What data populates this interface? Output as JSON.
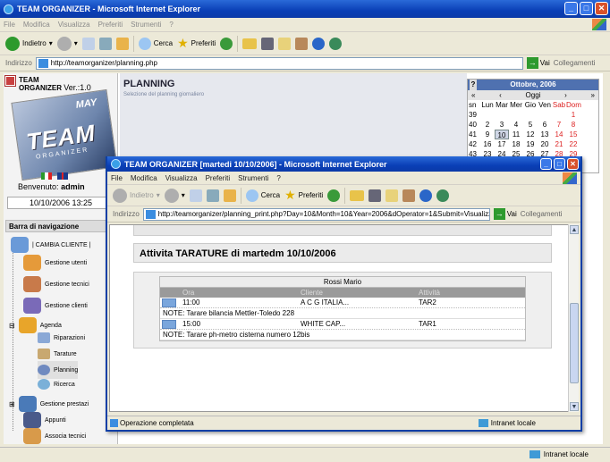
{
  "bg_window": {
    "title": "TEAM ORGANIZER - Microsoft Internet Explorer",
    "menu": [
      "File",
      "Modifica",
      "Visualizza",
      "Preferiti",
      "Strumenti",
      "?"
    ],
    "toolbar": {
      "back": "Indietro",
      "search": "Cerca",
      "favorites": "Preferiti"
    },
    "address_label": "Indirizzo",
    "address": "http://teamorganizer/planning.php",
    "go": "Vai",
    "links": "Collegamenti",
    "status_zone": "Intranet locale"
  },
  "sidebar": {
    "brand_line1": "TEAM",
    "brand_line2": "ORGANIZER",
    "version": "Ver.:1.0",
    "logo_may": "MAY",
    "logo_team": "TEAM",
    "logo_org": "ORGANIZER",
    "welcome_label": "Benvenuto:",
    "user": "admin",
    "datetime": "10/10/2006 13:25",
    "nav_title": "Barra di navigazione",
    "items": [
      {
        "label": "| CAMBIA CLIENTE |"
      },
      {
        "label": "Gestione utenti"
      },
      {
        "label": "Gestione tecnici"
      },
      {
        "label": "Gestione clienti"
      },
      {
        "label": "Agenda"
      },
      {
        "label": "Riparazioni"
      },
      {
        "label": "Tarature"
      },
      {
        "label": "Planning"
      },
      {
        "label": "Ricerca"
      },
      {
        "label": "Gestione prestazi"
      },
      {
        "label": "Appunti"
      },
      {
        "label": "Associa tecnici"
      }
    ]
  },
  "main": {
    "title": "PLANNING",
    "subtitle": "Selezione del planning giornaliero"
  },
  "calendar": {
    "help": "?",
    "month": "Ottobre, 2006",
    "prev_year": "«",
    "prev_month": "‹",
    "today": "Oggi",
    "next_month": "›",
    "next_year": "»",
    "week_label": "sn",
    "days": [
      "Lun",
      "Mar",
      "Mer",
      "Gio",
      "Ven",
      "Sab",
      "Dom"
    ],
    "weeks": [
      {
        "wk": "39",
        "d": [
          "",
          "",
          "",
          "",
          "",
          "",
          "1"
        ]
      },
      {
        "wk": "40",
        "d": [
          "2",
          "3",
          "4",
          "5",
          "6",
          "7",
          "8"
        ]
      },
      {
        "wk": "41",
        "d": [
          "9",
          "10",
          "11",
          "12",
          "13",
          "14",
          "15"
        ]
      },
      {
        "wk": "42",
        "d": [
          "16",
          "17",
          "18",
          "19",
          "20",
          "21",
          "22"
        ]
      },
      {
        "wk": "43",
        "d": [
          "23",
          "24",
          "25",
          "26",
          "27",
          "28",
          "29"
        ]
      }
    ]
  },
  "popup": {
    "title": "TEAM ORGANIZER [martedi 10/10/2006] - Microsoft Internet Explorer",
    "menu": [
      "File",
      "Modifica",
      "Visualizza",
      "Preferiti",
      "Strumenti",
      "?"
    ],
    "toolbar": {
      "back": "Indietro",
      "search": "Cerca",
      "favorites": "Preferiti"
    },
    "address_label": "Indirizzo",
    "address": "http://teamorganizer/planning_print.php?Day=10&Month=10&Year=2006&dOperator=1&Submit=Visualizza+plani",
    "go": "Vai",
    "links": "Collegamenti",
    "activity_title": "Attivita TARATURE di martedm 10/10/2006",
    "technician": "Rossi Mario",
    "columns": [
      "Ora",
      "Cliente",
      "Attività"
    ],
    "rows": [
      {
        "time": "11:00",
        "client": "A C G ITALIA...",
        "activity": "TAR2",
        "note": "NOTE: Tarare bilancia Mettler-Toledo 228"
      },
      {
        "time": "15:00",
        "client": "WHITE CAP...",
        "activity": "TAR1",
        "note": "NOTE: Tarare ph-metro cisterna numero 12bis"
      }
    ],
    "status": "Operazione completata",
    "status_zone": "Intranet locale"
  }
}
